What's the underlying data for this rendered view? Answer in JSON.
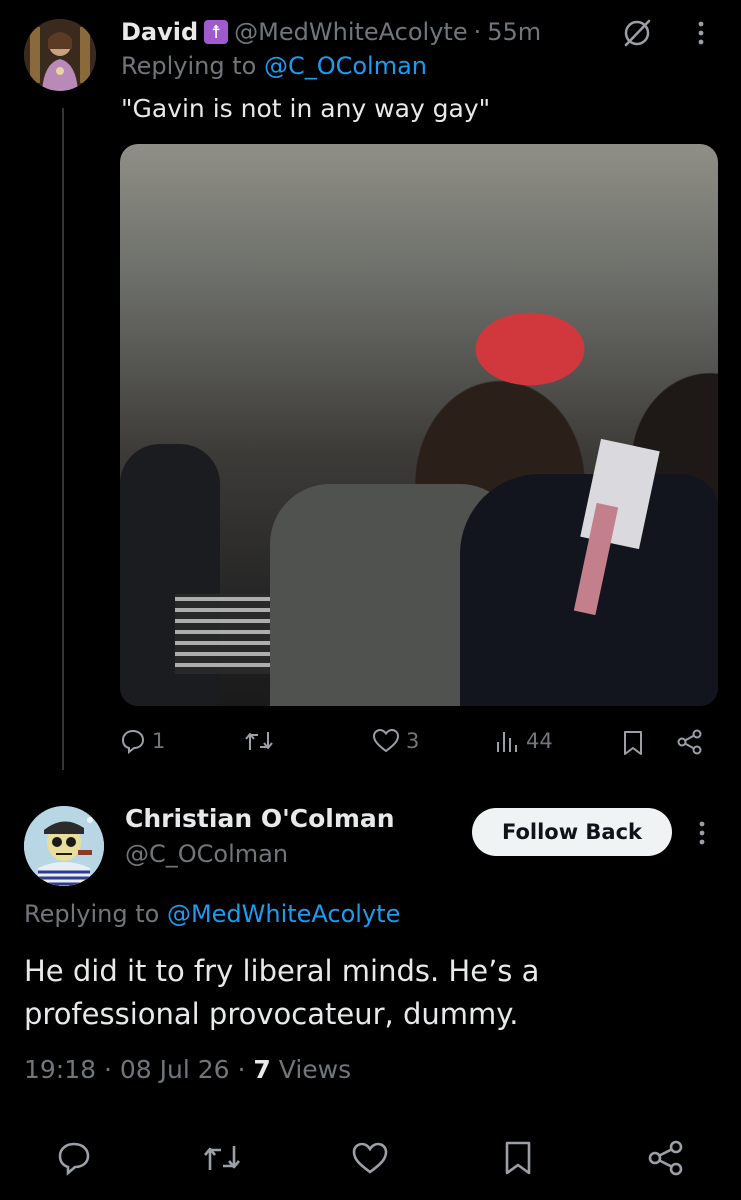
{
  "tweet1": {
    "author_name": "David",
    "emoji": "☨",
    "handle": "@MedWhiteAcolyte",
    "separator": "·",
    "time": "55m",
    "replying_prefix": "Replying to ",
    "replying_to": "@C_OColman",
    "text": "\"Gavin is not in any way gay\"",
    "reply_count": "1",
    "like_count": "3",
    "views_count": "44"
  },
  "tweet2": {
    "author_name": "Christian O'Colman",
    "handle": "@C_OColman",
    "follow_label": "Follow Back",
    "replying_prefix": "Replying to ",
    "replying_to": "@MedWhiteAcolyte",
    "text": "He did it to fry liberal minds. He’s a professional provocateur, dummy.",
    "time": "19:18",
    "sep1": " · ",
    "date": "08 Jul 26",
    "sep2": " · ",
    "views_count": "7",
    "views_label": " Views"
  },
  "colors": {
    "background": "#000000",
    "text": "#e7e9ea",
    "muted": "#71767b",
    "link": "#1d9bf0",
    "follow_button_bg": "#eff3f4"
  }
}
